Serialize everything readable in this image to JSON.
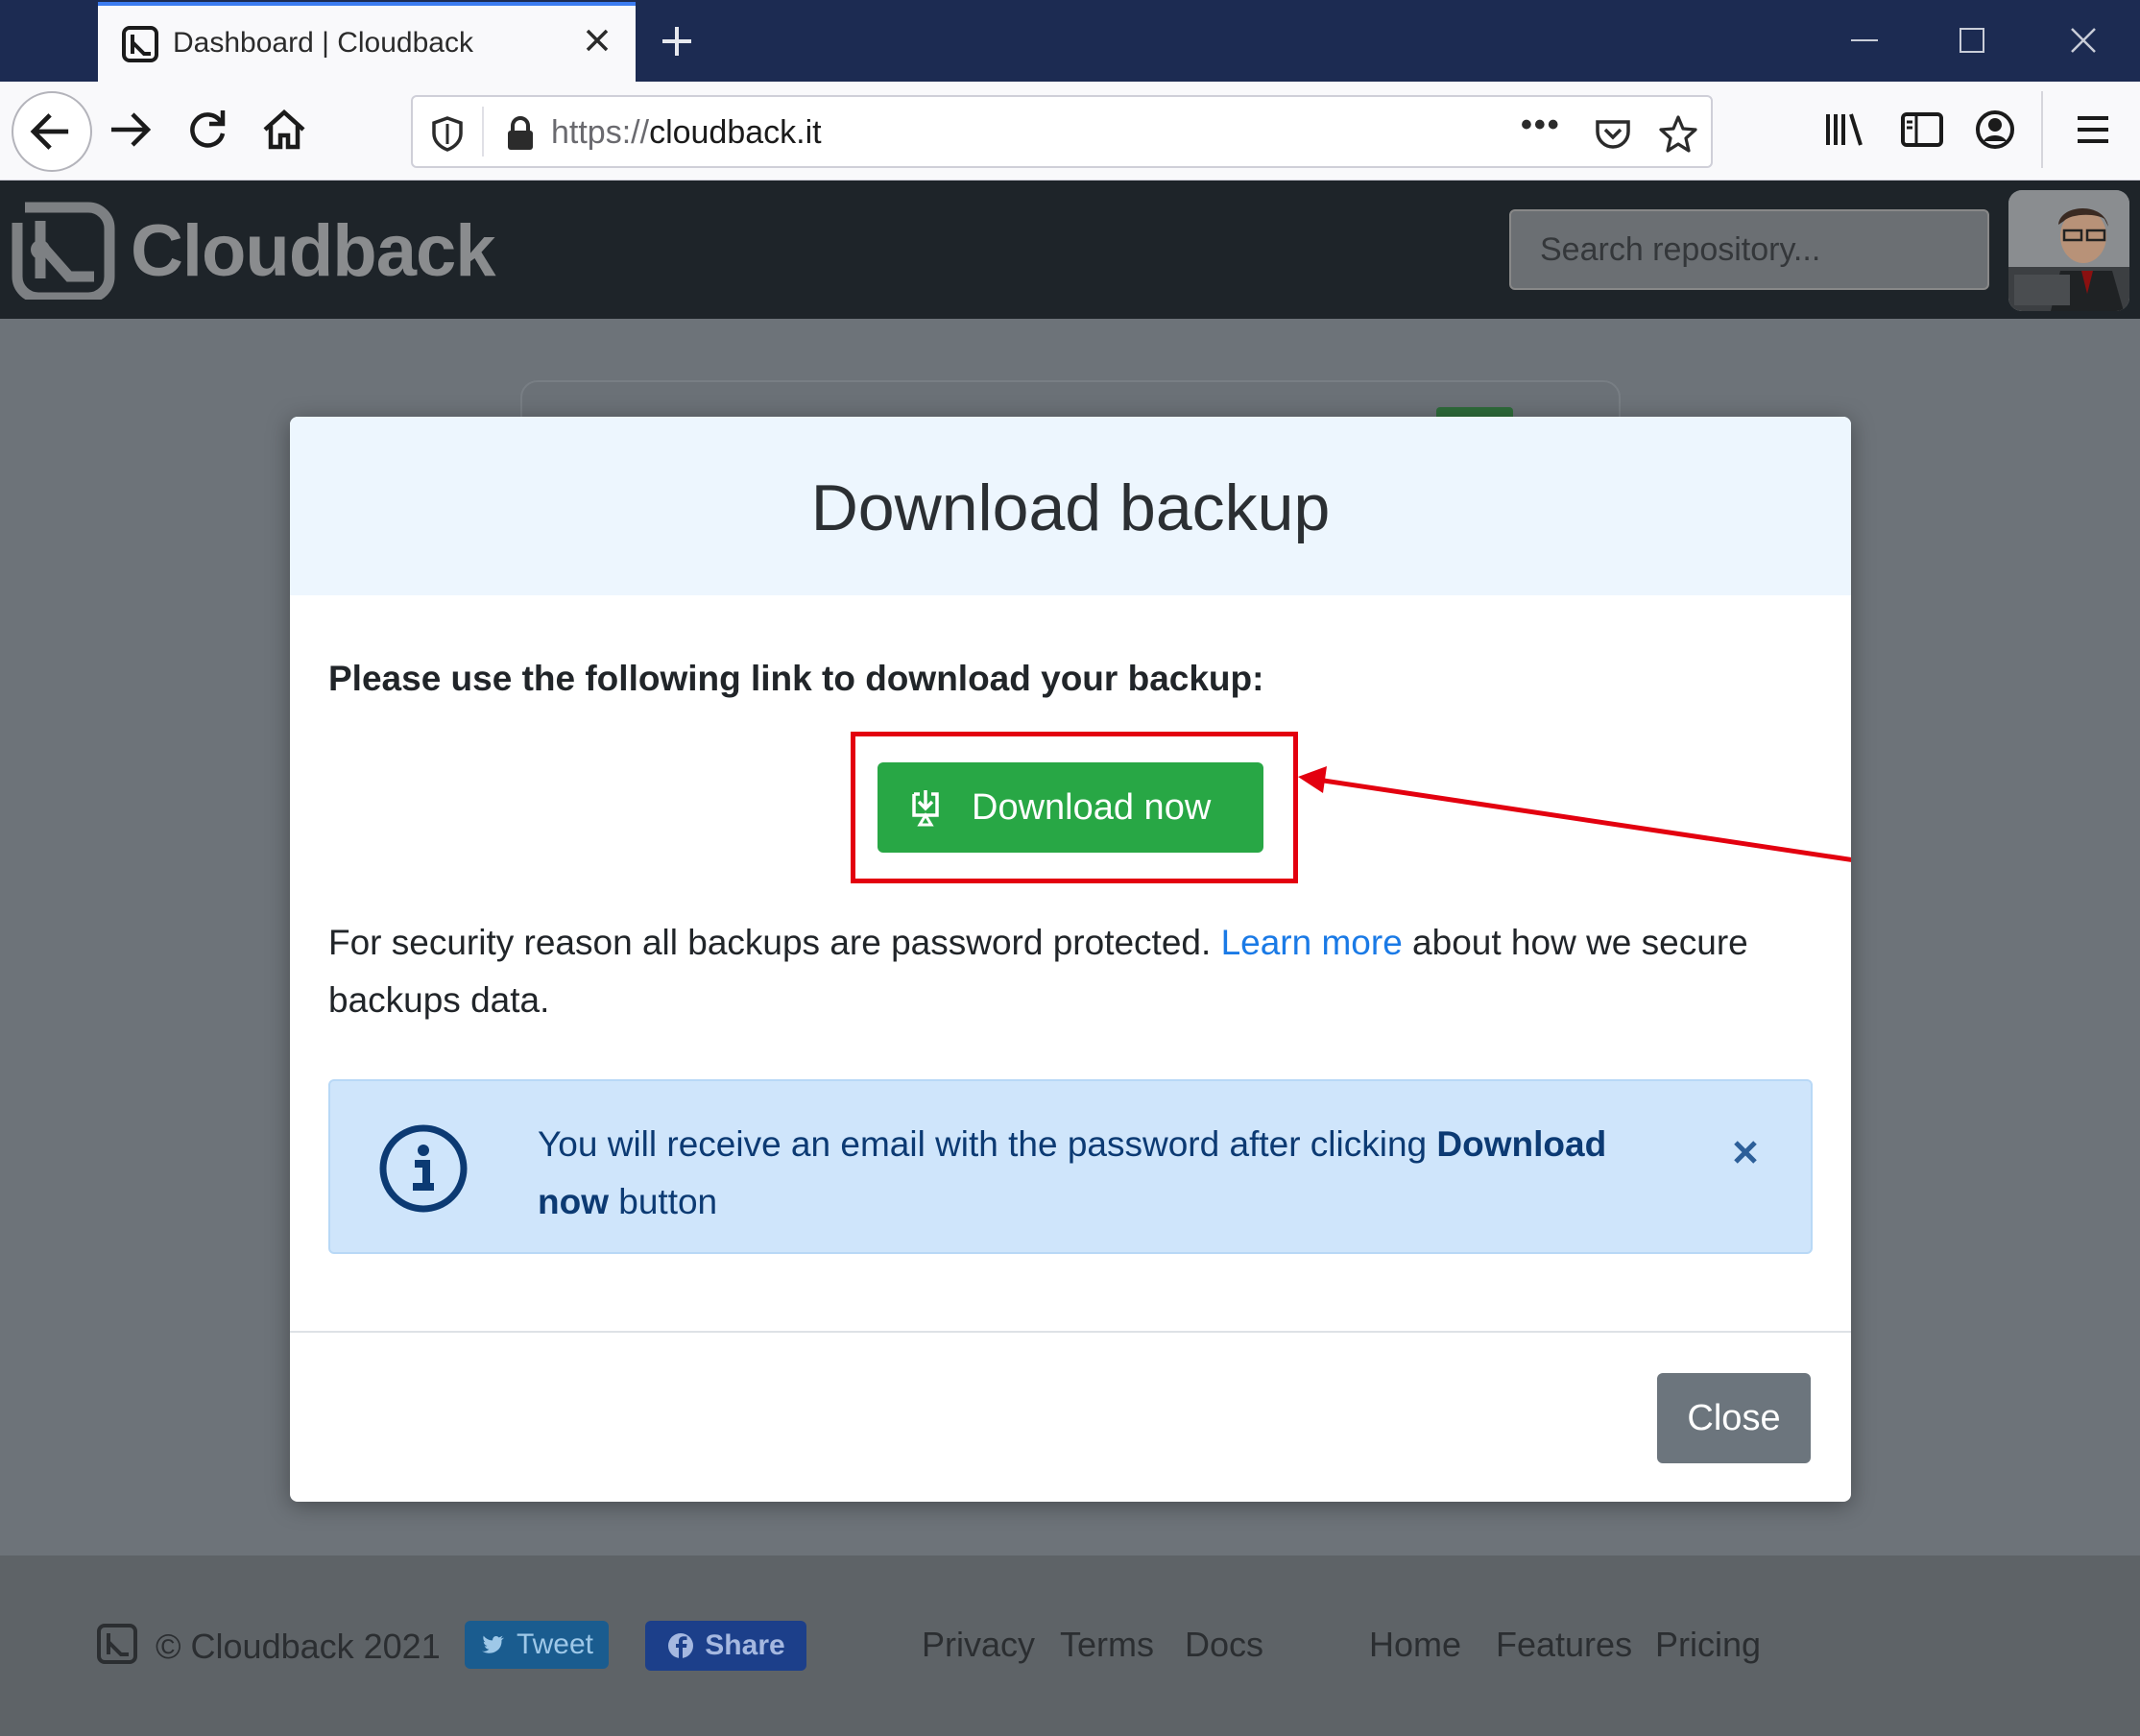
{
  "browser": {
    "tab_title": "Dashboard | Cloudback",
    "url_scheme": "https://",
    "url_host": "cloudback.it",
    "url_more_label": "•••"
  },
  "site": {
    "name": "Cloudback",
    "search_placeholder": "Search repository..."
  },
  "modal": {
    "title": "Download backup",
    "lead": "Please use the following link to download your backup:",
    "download_button": "Download now",
    "security_before": "For security reason all backups are password protected. ",
    "security_link": "Learn more",
    "security_after": " about how we secure backups data.",
    "alert_text_1": "You will receive an email with the password after clicking ",
    "alert_bold": "Download now",
    "alert_text_2": " button",
    "close_button": "Close"
  },
  "footer": {
    "copyright": "© Cloudback 2021",
    "tweet": "Tweet",
    "share": "Share",
    "links": [
      "Privacy",
      "Terms",
      "Docs",
      "Home",
      "Features",
      "Pricing"
    ]
  },
  "colors": {
    "success": "#28a745",
    "secondary": "#6c757d",
    "link": "#1a7ae6",
    "annotation": "#e3000f",
    "info_bg": "#cfe5fb"
  }
}
